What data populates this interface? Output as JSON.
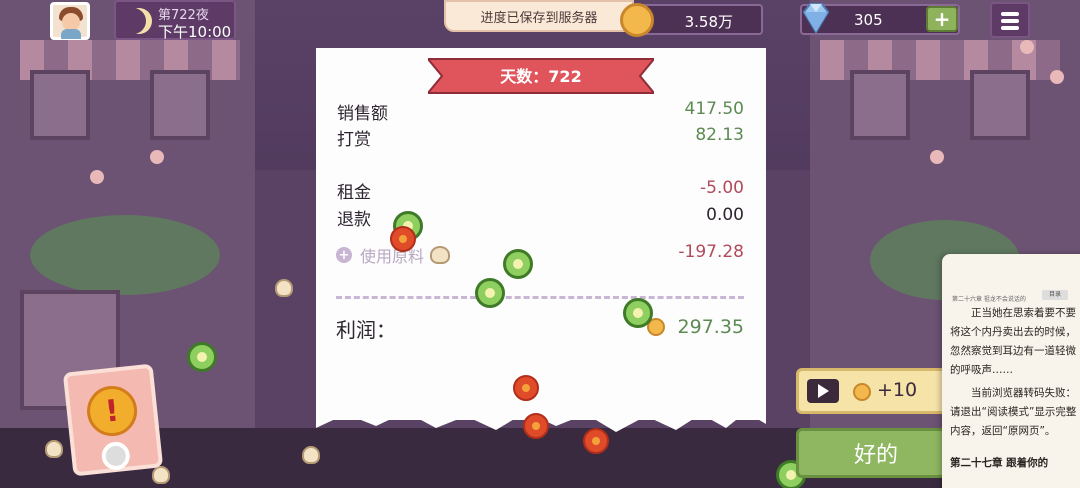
{
  "hud": {
    "day_label": "第722夜",
    "time_label": "下午10:00",
    "toast": "进度已保存到服务器",
    "coins": "3.58万",
    "gems": "305",
    "plus_label": "+"
  },
  "receipt": {
    "title": "天数：722",
    "sales_label": "销售额",
    "sales_value": "417.50",
    "tips_label": "打赏",
    "tips_value": "82.13",
    "rent_label": "租金",
    "rent_value": "-5.00",
    "refund_label": "退款",
    "refund_value": "0.00",
    "ingredients_label": "使用原料",
    "ingredients_value": "-197.28",
    "profit_label": "利润：",
    "profit_value": "297.35"
  },
  "ad_button": {
    "reward": "+10"
  },
  "ok_button": {
    "label": "好的"
  },
  "reader": {
    "chapter_header": "第二十六章 祖龙不会说话的",
    "badge": "目录",
    "para1": "正当她在思索着要不要将这个内丹卖出去的时候，忽然察觉到耳边有一道轻微的呼吸声……",
    "para2": "当前浏览器转码失败：请退出“阅读模式”显示完整内容，返回“原网页”。",
    "para3": "第二十七章 跟着你的"
  },
  "colors": {
    "profit_green": "#5d8a52",
    "loss_red": "#b24a5a",
    "ribbon_red": "#e0555c",
    "ok_green": "#8fb762"
  }
}
